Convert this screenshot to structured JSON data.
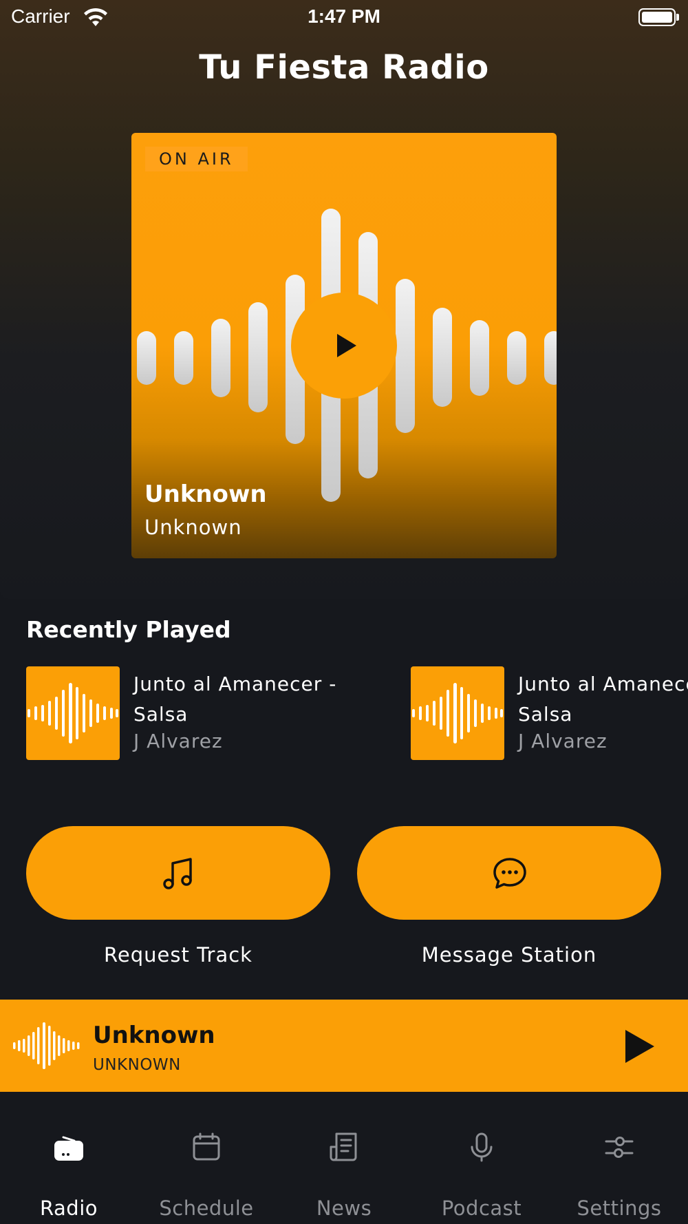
{
  "status_bar": {
    "carrier": "Carrier",
    "time": "1:47 PM"
  },
  "header": {
    "title": "Tu Fiesta Radio"
  },
  "now_playing": {
    "badge": "ON AIR",
    "title": "Unknown",
    "artist": "Unknown"
  },
  "recently_played": {
    "title": "Recently Played",
    "items": [
      {
        "title": "Junto al Amanecer - Salsa",
        "artist": "J Alvarez"
      },
      {
        "title": "Junto al Amanecer - Salsa",
        "artist": "J Alvarez"
      }
    ]
  },
  "actions": {
    "request_label": "Request Track",
    "message_label": "Message Station"
  },
  "mini_player": {
    "title": "Unknown",
    "artist": "UNKNOWN"
  },
  "tabs": [
    {
      "label": "Radio",
      "icon": "radio-icon",
      "active": true
    },
    {
      "label": "Schedule",
      "icon": "calendar-icon",
      "active": false
    },
    {
      "label": "News",
      "icon": "newspaper-icon",
      "active": false
    },
    {
      "label": "Podcast",
      "icon": "microphone-icon",
      "active": false
    },
    {
      "label": "Settings",
      "icon": "sliders-icon",
      "active": false
    }
  ],
  "colors": {
    "accent": "#fb9f06",
    "background": "#16181d",
    "muted_text": "#8e9095"
  }
}
